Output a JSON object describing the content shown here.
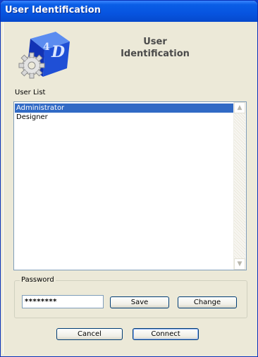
{
  "window": {
    "title": "User Identification"
  },
  "header": {
    "line1": "User",
    "line2": "Identification"
  },
  "user_list": {
    "label": "User List",
    "items": [
      {
        "label": "Administrator",
        "selected": true
      },
      {
        "label": "Designer",
        "selected": false
      }
    ]
  },
  "password_group": {
    "legend": "Password",
    "masked_value": "********",
    "save_label": "Save",
    "change_label": "Change"
  },
  "footer": {
    "cancel_label": "Cancel",
    "connect_label": "Connect"
  },
  "icons": {
    "logo": "4d-cube-gear-logo",
    "scroll_up": "scroll-up-arrow-icon",
    "scroll_down": "scroll-down-arrow-icon"
  },
  "colors": {
    "title_bar": "#0754e0",
    "dialog_bg": "#ece9d8",
    "selection": "#316ac5",
    "logo_blue": "#1f4fd6"
  }
}
